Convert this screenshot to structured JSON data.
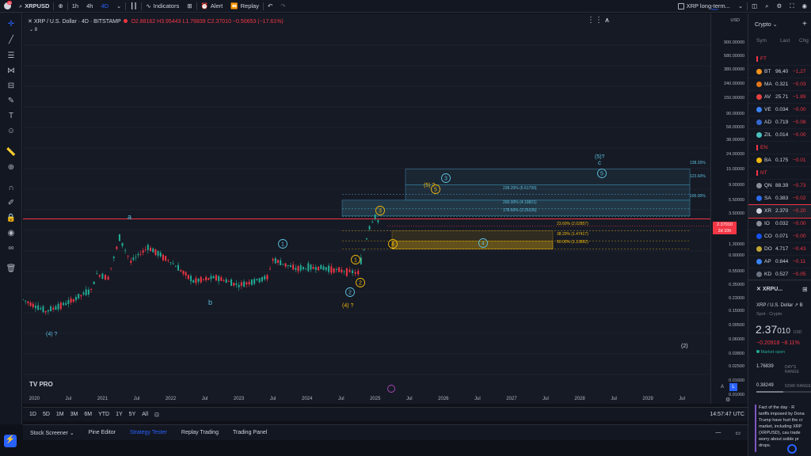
{
  "topbar": {
    "symbol": "XRPUSD",
    "intervals": [
      "1h",
      "4h",
      "4D"
    ],
    "indicators_label": "Indicators",
    "alert_label": "Alert",
    "replay_label": "Replay",
    "layout_name": "XRP long-term...",
    "layout_status": "Save",
    "notification_count": "10"
  },
  "legend": {
    "title": "XRP / U.S. Dollar · 4D · BITSTAMP",
    "ohlc_o": "O2.88162",
    "ohlc_h": "H3.95443",
    "ohlc_l": "L1.76839",
    "ohlc_c": "C2.37010",
    "ohlc_chg": "−0.50653 (−17.61%)",
    "count": "8"
  },
  "price_axis": {
    "currency": "USD",
    "labels": [
      "900.00000",
      "580.00000",
      "380.00000",
      "240.00000",
      "150.00000",
      "90.00000",
      "58.00000",
      "38.00000",
      "24.00000",
      "15.00000",
      "9.00000",
      "5.50000",
      "3.50000",
      "2.37010",
      "1.30000",
      "0.90000",
      "0.55000",
      "0.35000",
      "0.23000",
      "0.15000",
      "0.09500",
      "0.06000",
      "0.03800",
      "0.02500",
      "0.01600",
      "0.01000"
    ],
    "current_price": "2.37010",
    "countdown": "2d 10h"
  },
  "time_axis": {
    "labels": [
      "2020",
      "Jul",
      "2021",
      "Jul",
      "2022",
      "Jul",
      "2023",
      "Jul",
      "2024",
      "Jul",
      "2025",
      "Jul",
      "2026",
      "Jul",
      "2027",
      "Jul",
      "2028",
      "Jul",
      "2029",
      "Jul"
    ]
  },
  "chart_annotations": {
    "wave_a": "a",
    "wave_b": "b",
    "wave_4q_left": "(4) ?",
    "wave_4q": "(4) ?",
    "wave_5": "(5) ?",
    "wave_5q_top": "(5)?",
    "wave_c": "c",
    "wave_2": "(2)",
    "circle_1": "1",
    "circle_2": "2",
    "circle_3": "3",
    "circle_4": "4",
    "circle_5": "5",
    "fib_138": "138.20%",
    "fib_123": "123.60%",
    "fib_100": "100.00%",
    "fib_238": "238.20% (6.61799)",
    "fib_200": "200.00% (4.19821)",
    "fib_178": "178.60% (3.25336)",
    "fib_236": "23.60% (2.02857)",
    "fib_382": "38.20% (1.47417)",
    "fib_500": "50.00% (1.13892)",
    "logo": "TV PRO"
  },
  "range_bar": {
    "ranges": [
      "1D",
      "5D",
      "1M",
      "3M",
      "6M",
      "YTD",
      "1Y",
      "5Y",
      "All"
    ],
    "clock": "14:57:47 UTC",
    "scale_a": "A",
    "scale_l": "L"
  },
  "bottom_tabs": [
    "Stock Screener",
    "Pine Editor",
    "Strategy Tester",
    "Replay Trading",
    "Trading Panel"
  ],
  "watchlist": {
    "title": "Crypto",
    "col_sym": "Sym",
    "col_last": "Last",
    "col_chg": "Chg",
    "rows": [
      {
        "sym": "FT",
        "last": "",
        "chg": "",
        "color": "#f23645"
      },
      {
        "sym": "BT",
        "last": "96,40",
        "chg": "−1,27",
        "color": "#f7931a"
      },
      {
        "sym": "MA",
        "last": "0.321",
        "chg": "−0.03",
        "color": "#e2761b"
      },
      {
        "sym": "AV",
        "last": "25.71",
        "chg": "−1.89",
        "color": "#e84142"
      },
      {
        "sym": "VE",
        "last": "0.034",
        "chg": "−0.00",
        "color": "#3b82f6"
      },
      {
        "sym": "AD",
        "last": "0.719",
        "chg": "−0.08",
        "color": "#3468d1"
      },
      {
        "sym": "ZIL",
        "last": "0.014",
        "chg": "−0.00",
        "color": "#49c1bf"
      },
      {
        "sym": "EN",
        "last": "",
        "chg": "",
        "color": "#f23645"
      },
      {
        "sym": "BA",
        "last": "0.175",
        "chg": "−0.01",
        "color": "#f0b90b"
      },
      {
        "sym": "NT",
        "last": "",
        "chg": "",
        "color": "#f23645"
      },
      {
        "sym": "QN",
        "last": "88.39",
        "chg": "−0.73",
        "color": "#8b8d97"
      },
      {
        "sym": "SA",
        "last": "0.383",
        "chg": "−0.02",
        "color": "#2b6def"
      },
      {
        "sym": "XR",
        "last": "2.370",
        "chg": "−0.20",
        "color": "#d1d4dc"
      },
      {
        "sym": "IO",
        "last": "0.032",
        "chg": "−0.00",
        "color": "#8b8d97"
      },
      {
        "sym": "CO",
        "last": "0.071",
        "chg": "−0.00",
        "color": "#1652f0"
      },
      {
        "sym": "DO",
        "last": "4.717",
        "chg": "−0.43",
        "color": "#c2a633"
      },
      {
        "sym": "AP",
        "last": "0.844",
        "chg": "−0.11",
        "color": "#3b82f6"
      },
      {
        "sym": "KD",
        "last": "0.527",
        "chg": "−0.05",
        "color": "#6b7280"
      }
    ]
  },
  "details": {
    "symbol": "XRPU...",
    "name": "XRP / U.S. Dollar",
    "exchange": "B",
    "type": "Spot · Crypto",
    "price_main": "2.37",
    "price_tail": "010",
    "price_unit": "USD",
    "change": "−0.20918",
    "change_pct": "−8.11%",
    "market_status": "Market open",
    "low": "1.76839",
    "day_range": "DAY'S RANGE",
    "low52": "0.38249",
    "range52": "52WK RANGE",
    "news_lines": [
      "Fact of the day · R",
      "tariffs imposed by Dona",
      "Trump have hurt the cr",
      "market, including XRP",
      "(XRPUSD), cau   trade",
      "worry about   ssible pr",
      "drops."
    ]
  },
  "chart_data": {
    "type": "candlestick",
    "title": "XRP / U.S. Dollar · 4D · BITSTAMP",
    "y_scale": "log",
    "ylim": [
      0.01,
      900
    ],
    "x_range": [
      "2019-11",
      "2029-12"
    ],
    "horizontal_line": 3.0,
    "approx_close_path": [
      {
        "x": "2019-11",
        "y": 0.22
      },
      {
        "x": "2020-03",
        "y": 0.15
      },
      {
        "x": "2020-07",
        "y": 0.2
      },
      {
        "x": "2020-11",
        "y": 0.3
      },
      {
        "x": "2020-12",
        "y": 0.5
      },
      {
        "x": "2021-02",
        "y": 0.45
      },
      {
        "x": "2021-04",
        "y": 1.6
      },
      {
        "x": "2021-06",
        "y": 0.75
      },
      {
        "x": "2021-09",
        "y": 1.2
      },
      {
        "x": "2022-01",
        "y": 0.75
      },
      {
        "x": "2022-05",
        "y": 0.4
      },
      {
        "x": "2022-09",
        "y": 0.45
      },
      {
        "x": "2023-01",
        "y": 0.35
      },
      {
        "x": "2023-06",
        "y": 0.45
      },
      {
        "x": "2023-07",
        "y": 0.8
      },
      {
        "x": "2023-11",
        "y": 0.6
      },
      {
        "x": "2024-03",
        "y": 0.62
      },
      {
        "x": "2024-08",
        "y": 0.55
      },
      {
        "x": "2024-10",
        "y": 0.52
      },
      {
        "x": "2024-11",
        "y": 1.1
      },
      {
        "x": "2024-12",
        "y": 2.3
      },
      {
        "x": "2025-01",
        "y": 3.3
      },
      {
        "x": "2025-02",
        "y": 2.37
      }
    ],
    "fib_levels": [
      {
        "label": "238.20%",
        "value": 6.61799
      },
      {
        "label": "200.00%",
        "value": 4.19821
      },
      {
        "label": "178.60%",
        "value": 3.25336
      },
      {
        "label": "23.60%",
        "value": 2.02857
      },
      {
        "label": "38.20%",
        "value": 1.47417
      },
      {
        "label": "50.00%",
        "value": 1.13892
      }
    ]
  }
}
